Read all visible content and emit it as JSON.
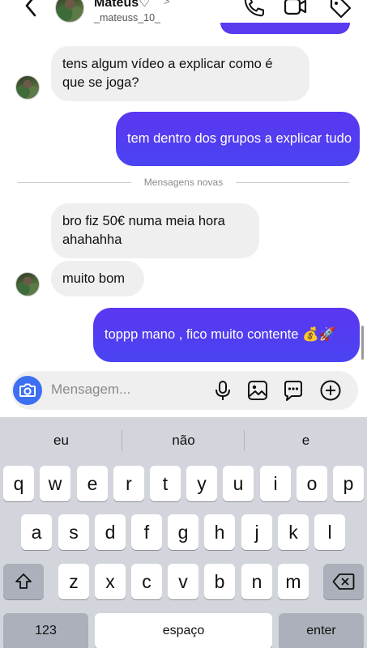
{
  "header": {
    "name": "Mateus♡",
    "username": "_mateuss_10_",
    "icons": [
      "back-chevron-icon",
      "phone-icon",
      "video-camera-icon",
      "tag-icon"
    ]
  },
  "messages": [
    {
      "from": "them",
      "text": "tens algum vídeo a explicar como é que se joga?"
    },
    {
      "from": "me",
      "text": "tem dentro dos grupos a explicar tudo"
    },
    {
      "from": "them",
      "text": "bro fiz 50€ numa meia hora ahahahha"
    },
    {
      "from": "them",
      "text": "muito bom"
    },
    {
      "from": "me",
      "text": "toppp mano , fico muito contente 💰🚀"
    }
  ],
  "divider_label": "Mensagens novas",
  "composer": {
    "placeholder": "Mensagem...",
    "icons": [
      "camera-icon",
      "microphone-icon",
      "gallery-icon",
      "sticker-icon",
      "plus-icon"
    ]
  },
  "keyboard": {
    "suggestions": [
      "eu",
      "não",
      "e"
    ],
    "row1": [
      "q",
      "w",
      "e",
      "r",
      "t",
      "y",
      "u",
      "i",
      "o",
      "p"
    ],
    "row2": [
      "a",
      "s",
      "d",
      "f",
      "g",
      "h",
      "j",
      "k",
      "l"
    ],
    "row3": [
      "z",
      "x",
      "c",
      "v",
      "b",
      "n",
      "m"
    ],
    "numbers_key": "123",
    "space_key": "espaço",
    "enter_key": "enter"
  },
  "colors": {
    "outgoing": "#5a3bef",
    "incoming": "#efefef",
    "camera_button": "#3d6ff2",
    "keyboard_bg": "#d3d5dc"
  }
}
